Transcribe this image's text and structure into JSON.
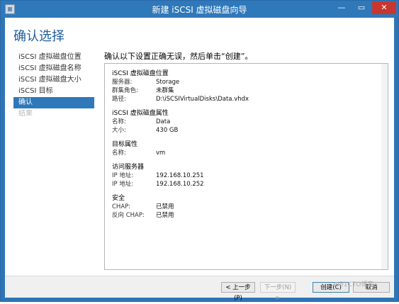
{
  "window": {
    "title": "新建 iSCSI 虚拟磁盘向导",
    "controls": {
      "minimize": "—",
      "maximize": "▭",
      "close": "✕"
    }
  },
  "page_title": "确认选择",
  "nav": [
    {
      "label": "iSCSI 虚拟磁盘位置",
      "state": "normal"
    },
    {
      "label": "iSCSI 虚拟磁盘名称",
      "state": "normal"
    },
    {
      "label": "iSCSI 虚拟磁盘大小",
      "state": "normal"
    },
    {
      "label": "iSCSI 目标",
      "state": "normal"
    },
    {
      "label": "确认",
      "state": "active"
    },
    {
      "label": "结果",
      "state": "disabled"
    }
  ],
  "heading": "确认以下设置正确无误，然后单击“创建”。",
  "sections": [
    {
      "title": "iSCSI 虚拟磁盘位置",
      "rows": [
        {
          "key": "服务器:",
          "value": "Storage"
        },
        {
          "key": "群集角色:",
          "value": "未群集"
        },
        {
          "key": "路径:",
          "value": "D:\\iSCSIVirtualDisks\\Data.vhdx"
        }
      ]
    },
    {
      "title": "iSCSI 虚拟磁盘属性",
      "rows": [
        {
          "key": "名称:",
          "value": "Data"
        },
        {
          "key": "大小:",
          "value": "430 GB"
        }
      ]
    },
    {
      "title": "目标属性",
      "rows": [
        {
          "key": "名称:",
          "value": "vm"
        }
      ]
    },
    {
      "title": "访问服务器",
      "rows": [
        {
          "key": "IP 地址:",
          "value": "192.168.10.251"
        },
        {
          "key": "IP 地址:",
          "value": "192.168.10.252"
        }
      ]
    },
    {
      "title": "安全",
      "rows": [
        {
          "key": "CHAP:",
          "value": "已禁用"
        },
        {
          "key": "反向 CHAP:",
          "value": "已禁用"
        }
      ]
    }
  ],
  "buttons": {
    "previous": "< 上一步(P)",
    "next": "下一步(N) >",
    "create": "创建(C)",
    "cancel": "取消"
  },
  "watermark": "@51CTO博客"
}
